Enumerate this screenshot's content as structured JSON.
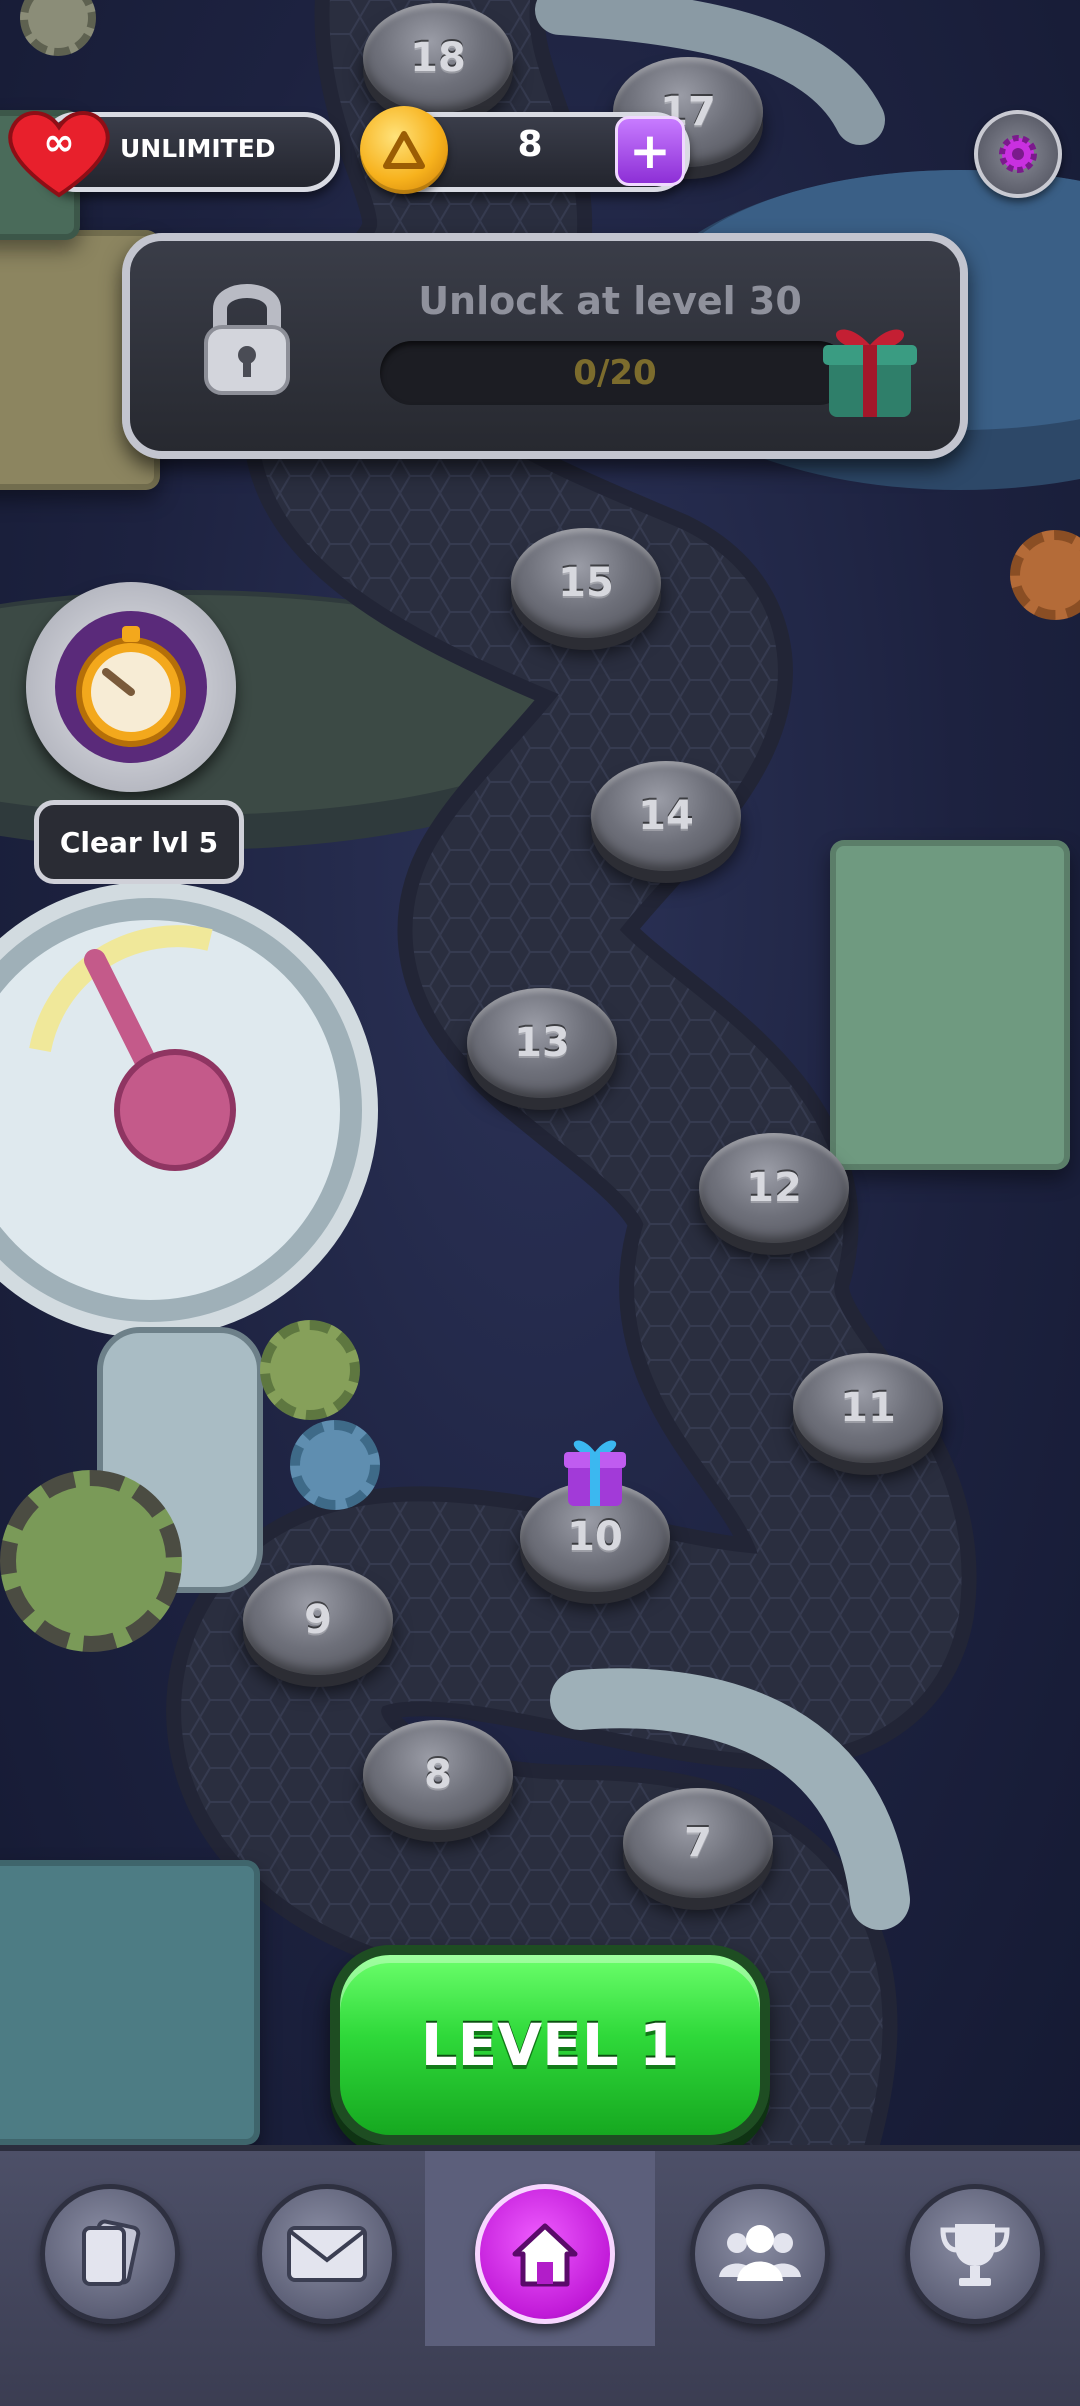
{
  "hud": {
    "lives_label": "UNLIMITED",
    "coins": "8",
    "add_coins_label": "+"
  },
  "unlock_panel": {
    "title": "Unlock at level 30",
    "progress_text": "0/20",
    "progress_fraction": 0
  },
  "event": {
    "label": "Clear lvl 5"
  },
  "levels": [
    "18",
    "17",
    "15",
    "14",
    "13",
    "12",
    "11",
    "10",
    "9",
    "8",
    "7"
  ],
  "play_button": {
    "label": "LEVEL 1"
  },
  "bottom_nav": {
    "items": [
      "cards-icon",
      "mail-icon",
      "home-icon",
      "friends-icon",
      "trophy-icon"
    ],
    "active": "home-icon"
  },
  "colors": {
    "play_green": "#2fd93a",
    "accent_purple": "#c11ad8",
    "coin_gold": "#f7b21d",
    "heart_red": "#e8202c"
  }
}
